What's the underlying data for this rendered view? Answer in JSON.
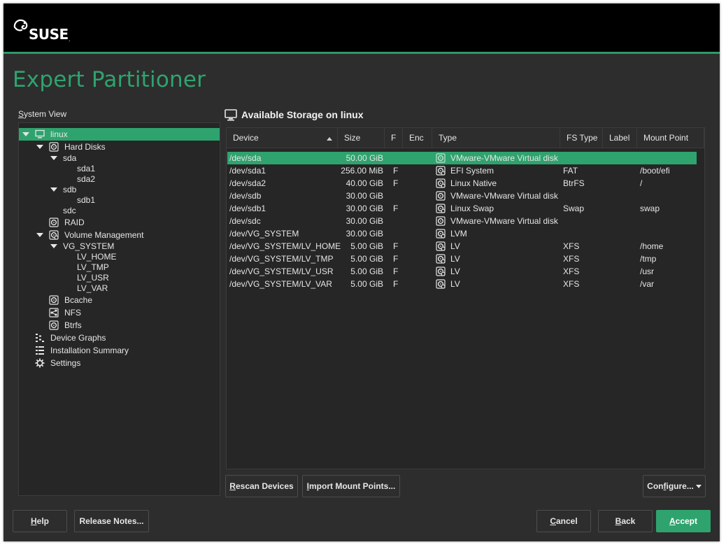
{
  "brand": {
    "logo_text": "SUSE"
  },
  "page_title": "Expert Partitioner",
  "system_view": {
    "label_underlined": "S",
    "label_rest": "ystem View",
    "tree": [
      {
        "label": "linux",
        "icon": "computer-icon",
        "depth": 0,
        "expanded": true,
        "selected": true
      },
      {
        "label": "Hard Disks",
        "icon": "hard-disk-icon",
        "depth": 1,
        "expanded": true
      },
      {
        "label": "sda",
        "icon": "",
        "depth": 2,
        "expanded": true
      },
      {
        "label": "sda1",
        "icon": "",
        "depth": 3
      },
      {
        "label": "sda2",
        "icon": "",
        "depth": 3
      },
      {
        "label": "sdb",
        "icon": "",
        "depth": 2,
        "expanded": true
      },
      {
        "label": "sdb1",
        "icon": "",
        "depth": 3
      },
      {
        "label": "sdc",
        "icon": "",
        "depth": 2
      },
      {
        "label": "RAID",
        "icon": "raid-icon",
        "depth": 1
      },
      {
        "label": "Volume Management",
        "icon": "volume-management-icon",
        "depth": 1,
        "expanded": true
      },
      {
        "label": "VG_SYSTEM",
        "icon": "",
        "depth": 2,
        "expanded": true
      },
      {
        "label": "LV_HOME",
        "icon": "",
        "depth": 3
      },
      {
        "label": "LV_TMP",
        "icon": "",
        "depth": 3
      },
      {
        "label": "LV_USR",
        "icon": "",
        "depth": 3
      },
      {
        "label": "LV_VAR",
        "icon": "",
        "depth": 3
      },
      {
        "label": "Bcache",
        "icon": "bcache-icon",
        "depth": 1
      },
      {
        "label": "NFS",
        "icon": "nfs-icon",
        "depth": 1
      },
      {
        "label": "Btrfs",
        "icon": "btrfs-icon",
        "depth": 1
      },
      {
        "label": "Device Graphs",
        "icon": "device-graphs-icon",
        "depth": 0
      },
      {
        "label": "Installation Summary",
        "icon": "installation-summary-icon",
        "depth": 0
      },
      {
        "label": "Settings",
        "icon": "settings-gear-icon",
        "depth": 0
      }
    ]
  },
  "storage": {
    "title": "Available Storage on linux",
    "columns": [
      "Device",
      "Size",
      "F",
      "Enc",
      "Type",
      "FS Type",
      "Label",
      "Mount Point"
    ],
    "sort_column": "Device",
    "rows": [
      {
        "device": "/dev/sda",
        "size": "50.00 GiB",
        "f": "",
        "enc": "",
        "type": "VMware-VMware Virtual disk",
        "fs_type": "",
        "label": "",
        "mount": "",
        "icon": "disk-icon",
        "selected": true
      },
      {
        "device": "/dev/sda1",
        "size": "256.00 MiB",
        "f": "F",
        "enc": "",
        "type": "EFI System",
        "fs_type": "FAT",
        "label": "",
        "mount": "/boot/efi",
        "icon": "partition-icon"
      },
      {
        "device": "/dev/sda2",
        "size": "40.00 GiB",
        "f": "F",
        "enc": "",
        "type": "Linux Native",
        "fs_type": "BtrFS",
        "label": "",
        "mount": "/",
        "icon": "partition-icon"
      },
      {
        "device": "/dev/sdb",
        "size": "30.00 GiB",
        "f": "",
        "enc": "",
        "type": "VMware-VMware Virtual disk",
        "fs_type": "",
        "label": "",
        "mount": "",
        "icon": "disk-icon"
      },
      {
        "device": "/dev/sdb1",
        "size": "30.00 GiB",
        "f": "F",
        "enc": "",
        "type": "Linux Swap",
        "fs_type": "Swap",
        "label": "",
        "mount": "swap",
        "icon": "partition-icon"
      },
      {
        "device": "/dev/sdc",
        "size": "30.00 GiB",
        "f": "",
        "enc": "",
        "type": "VMware-VMware Virtual disk",
        "fs_type": "",
        "label": "",
        "mount": "",
        "icon": "disk-icon"
      },
      {
        "device": "/dev/VG_SYSTEM",
        "size": "30.00 GiB",
        "f": "",
        "enc": "",
        "type": "LVM",
        "fs_type": "",
        "label": "",
        "mount": "",
        "icon": "lvm-icon"
      },
      {
        "device": "/dev/VG_SYSTEM/LV_HOME",
        "size": "5.00 GiB",
        "f": "F",
        "enc": "",
        "type": "LV",
        "fs_type": "XFS",
        "label": "",
        "mount": "/home",
        "icon": "partition-icon"
      },
      {
        "device": "/dev/VG_SYSTEM/LV_TMP",
        "size": "5.00 GiB",
        "f": "F",
        "enc": "",
        "type": "LV",
        "fs_type": "XFS",
        "label": "",
        "mount": "/tmp",
        "icon": "partition-icon"
      },
      {
        "device": "/dev/VG_SYSTEM/LV_USR",
        "size": "5.00 GiB",
        "f": "F",
        "enc": "",
        "type": "LV",
        "fs_type": "XFS",
        "label": "",
        "mount": "/usr",
        "icon": "partition-icon"
      },
      {
        "device": "/dev/VG_SYSTEM/LV_VAR",
        "size": "5.00 GiB",
        "f": "F",
        "enc": "",
        "type": "LV",
        "fs_type": "XFS",
        "label": "",
        "mount": "/var",
        "icon": "partition-icon"
      }
    ]
  },
  "buttons": {
    "rescan": {
      "u": "R",
      "rest": "escan Devices"
    },
    "import": {
      "u": "I",
      "rest": "mport Mount Points..."
    },
    "configure": {
      "pre": "Con",
      "u": "f",
      "rest": "igure..."
    },
    "help": {
      "u": "H",
      "rest": "elp"
    },
    "release_notes": {
      "pre": "Release Notes...",
      "u": "",
      "rest": ""
    },
    "cancel": {
      "u": "C",
      "rest": "ancel"
    },
    "back": {
      "u": "B",
      "rest": "ack"
    },
    "accept": {
      "u": "A",
      "rest": "ccept"
    }
  },
  "colors": {
    "accent": "#2fa36e",
    "background": "#2d2d2d",
    "topbar": "#000000"
  }
}
